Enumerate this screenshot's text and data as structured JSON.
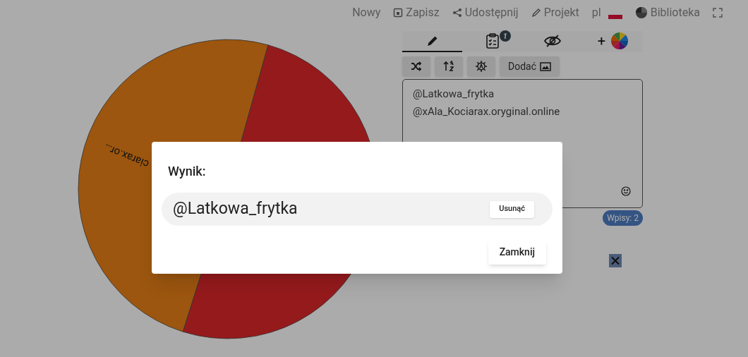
{
  "nav": [
    {
      "kind": "text",
      "label": "Nowy"
    },
    {
      "kind": "save",
      "label": "Zapisz"
    },
    {
      "kind": "share",
      "label": "Udostępnij"
    },
    {
      "kind": "pencil",
      "label": "Projekt"
    },
    {
      "kind": "lang",
      "label": "pl"
    },
    {
      "kind": "library",
      "label": "Biblioteka"
    },
    {
      "kind": "fullscreen"
    }
  ],
  "tabs": [
    {
      "kind": "pencil",
      "selected": true
    },
    {
      "kind": "clipboard",
      "selected": false,
      "badge": "1"
    },
    {
      "kind": "eye-off",
      "selected": false
    },
    {
      "kind": "colors",
      "selected": false,
      "label": "+"
    }
  ],
  "toolbar": [
    {
      "kind": "shuffle"
    },
    {
      "kind": "sort"
    },
    {
      "kind": "gear"
    },
    {
      "kind": "image",
      "label": "Dodać"
    }
  ],
  "entries": {
    "lines": [
      "@Latkowa_frytka",
      "@xAla_Kociarax.oryginal.online"
    ],
    "count": "Wpisy: 2"
  },
  "wheel": {
    "segments": [
      {
        "color": "#9c560f"
      },
      {
        "color": "#951a1c"
      }
    ],
    "label": "ciarax.or…"
  },
  "dialog": {
    "title": "Wynik:",
    "result": "@Latkowa_frytka",
    "remove": "Usunąć",
    "close": "Zamknij"
  }
}
